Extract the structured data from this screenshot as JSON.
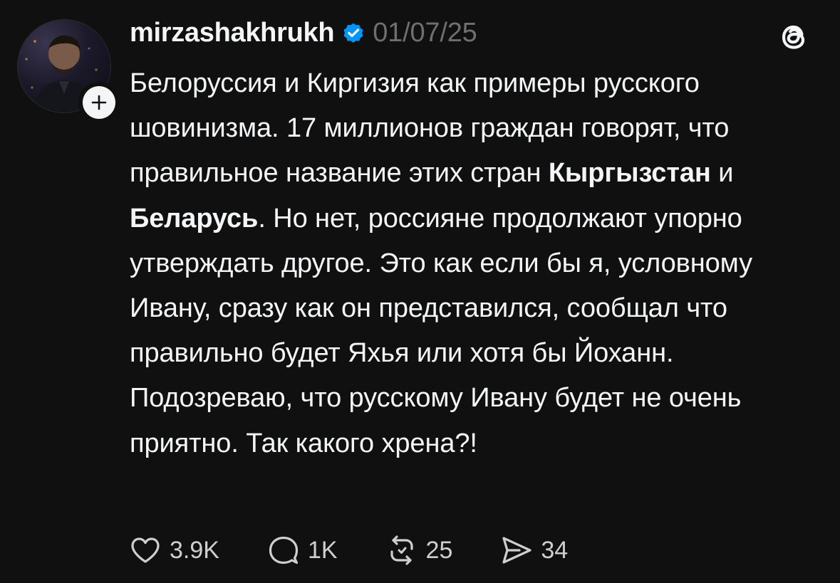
{
  "post": {
    "username": "mirzashakhrukh",
    "date": "01/07/25",
    "body": {
      "p1": "Белоруссия и Киргизия как примеры русского шовинизма. 17 миллионов граждан говорят, что правильное название этих стран ",
      "bold1": "Кыргызстан",
      "p2": " и ",
      "bold2": "Беларусь",
      "p3": ". Но нет, россияне продолжают упорно утверждать другое. Это как если бы я, условному Ивану, сразу как он представился, сообщал что правильно будет Яхья или хотя бы Йоханн. Подозреваю, что русскому Ивану будет не очень приятно. Так какого хрена?!"
    },
    "actions": {
      "likes": "3.9K",
      "replies": "1K",
      "reposts": "25",
      "shares": "34"
    },
    "icons": {
      "verified": "verified-badge-icon",
      "follow": "plus-icon",
      "logo": "threads-logo-icon",
      "like": "heart-icon",
      "reply": "comment-icon",
      "repost": "repost-icon",
      "share": "send-icon"
    },
    "colors": {
      "background": "#101010",
      "text": "#f3f5f7",
      "muted": "#6f6f6f",
      "verified": "#0095f6"
    }
  }
}
